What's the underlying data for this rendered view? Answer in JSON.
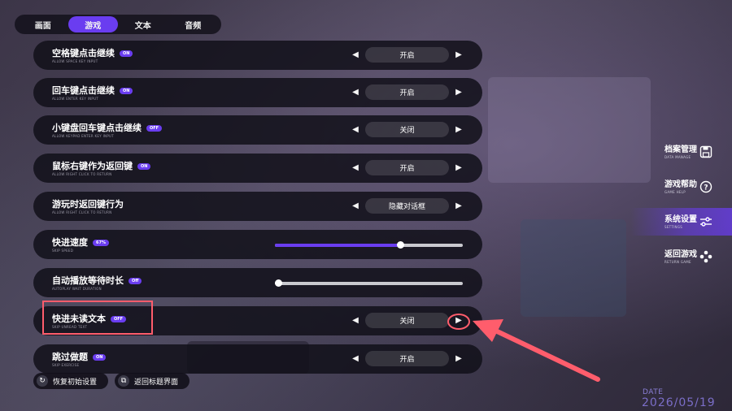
{
  "tabs": [
    {
      "label": "画面"
    },
    {
      "label": "游戏"
    },
    {
      "label": "文本"
    },
    {
      "label": "音频"
    }
  ],
  "active_tab": "游戏",
  "settings": [
    {
      "title": "空格键点击继续",
      "subtitle": "ALLOW SPACE KEY INPUT",
      "badge": "ON",
      "control": "select",
      "value": "开启"
    },
    {
      "title": "回车键点击继续",
      "subtitle": "ALLOW ENTER KEY INPUT",
      "badge": "ON",
      "control": "select",
      "value": "开启"
    },
    {
      "title": "小键盘回车键点击继续",
      "subtitle": "ALLOW KEYPAD ENTER KEY INPUT",
      "badge": "OFF",
      "control": "select",
      "value": "关闭"
    },
    {
      "title": "鼠标右键作为返回键",
      "subtitle": "ALLOW RIGHT CLICK TO RETURN",
      "badge": "ON",
      "control": "select",
      "value": "开启"
    },
    {
      "title": "游玩时返回键行为",
      "subtitle": "ALLOW RIGHT CLICK TO RETURN",
      "badge": "",
      "control": "select",
      "value": "隐藏对话框"
    },
    {
      "title": "快进速度",
      "subtitle": "SKIP SPEED",
      "badge": "67%",
      "control": "slider",
      "level": 0.67
    },
    {
      "title": "自动播放等待时长",
      "subtitle": "AUTOPLAY WAIT DURATION",
      "badge": "Off",
      "control": "slider",
      "level": 0.02
    },
    {
      "title": "快进未读文本",
      "subtitle": "SKIP UNREAD TEXT",
      "badge": "OFF",
      "control": "select",
      "value": "关闭"
    },
    {
      "title": "跳过做题",
      "subtitle": "SKIP EXERCISE",
      "badge": "ON",
      "control": "select",
      "value": "开启"
    }
  ],
  "bottom_buttons": {
    "reset_label": "恢复初始设置",
    "title_label": "返回标题界面"
  },
  "right_menu": [
    {
      "cn": "档案管理",
      "en": "DATA MANAGE",
      "icon": "save-icon",
      "active": false
    },
    {
      "cn": "游戏帮助",
      "en": "GAME HELP",
      "icon": "help-icon",
      "active": false
    },
    {
      "cn": "系统设置",
      "en": "SETTINGS",
      "icon": "sliders-icon",
      "active": true
    },
    {
      "cn": "返回游戏",
      "en": "RETURN GAME",
      "icon": "gamepad-icon",
      "active": false
    }
  ],
  "date": {
    "label": "DATE",
    "value": "2026/05/19"
  },
  "colors": {
    "accent": "#6a3df0",
    "highlight": "#ff5d6c"
  }
}
